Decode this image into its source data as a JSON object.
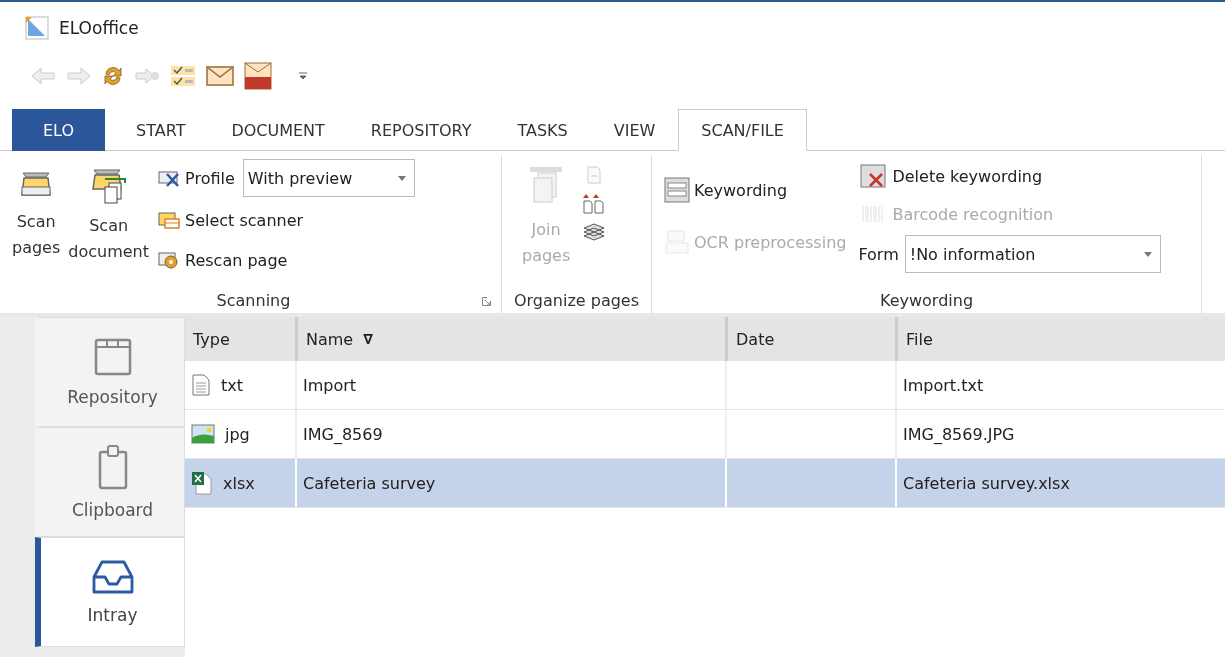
{
  "window": {
    "title": "ELOoffice"
  },
  "tabs": [
    {
      "label": "ELO",
      "kind": "app",
      "selected": false
    },
    {
      "label": "START",
      "kind": "tab",
      "selected": false
    },
    {
      "label": "DOCUMENT",
      "kind": "tab",
      "selected": false
    },
    {
      "label": "REPOSITORY",
      "kind": "tab",
      "selected": false
    },
    {
      "label": "TASKS",
      "kind": "tab",
      "selected": false
    },
    {
      "label": "VIEW",
      "kind": "tab",
      "selected": false
    },
    {
      "label": "SCAN/FILE",
      "kind": "tab",
      "selected": true
    }
  ],
  "ribbon": {
    "scanning": {
      "label": "Scanning",
      "large_buttons": [
        {
          "label": "Scan pages",
          "kind": "scanner"
        },
        {
          "label": "Scan document",
          "kind": "scan-doc"
        }
      ],
      "profile": {
        "label": "Profile",
        "value": "With preview"
      },
      "small_buttons": [
        {
          "label": "Select scanner",
          "kind": "select"
        },
        {
          "label": "Rescan page",
          "kind": "rescan"
        }
      ]
    },
    "organize": {
      "label": "Organize pages",
      "join": {
        "label": "Join pages",
        "disabled": true
      }
    },
    "keywording": {
      "label": "Keywording",
      "items": [
        {
          "label": "Keywording",
          "kind": "form",
          "disabled": false
        },
        {
          "label": "OCR preprocessing",
          "kind": "ocr",
          "disabled": true
        }
      ],
      "items_right": [
        {
          "label": "Delete keywording",
          "kind": "delete",
          "disabled": false
        },
        {
          "label": "Barcode recognition",
          "kind": "barcode",
          "disabled": true
        }
      ],
      "form": {
        "label": "Form",
        "value": "!No information"
      }
    }
  },
  "sidebar": {
    "items": [
      {
        "label": "Repository",
        "kind": "repository",
        "selected": false
      },
      {
        "label": "Clipboard",
        "kind": "clipboard",
        "selected": false
      },
      {
        "label": "Intray",
        "kind": "intray",
        "selected": true
      }
    ]
  },
  "table": {
    "columns": [
      {
        "label": "Type"
      },
      {
        "label": "Name",
        "sort_mark": "∇"
      },
      {
        "label": "Date"
      },
      {
        "label": "File"
      }
    ],
    "rows": [
      {
        "kind": "text",
        "type": "txt",
        "name": "Import",
        "file": "Import.txt",
        "selected": false
      },
      {
        "kind": "image",
        "type": "jpg",
        "name": "IMG_8569",
        "file": "IMG_8569.JPG",
        "selected": false
      },
      {
        "kind": "spreadsheet",
        "type": "xlsx",
        "name": "Cafeteria survey",
        "file": "Cafeteria survey.xlsx",
        "selected": true
      }
    ]
  }
}
